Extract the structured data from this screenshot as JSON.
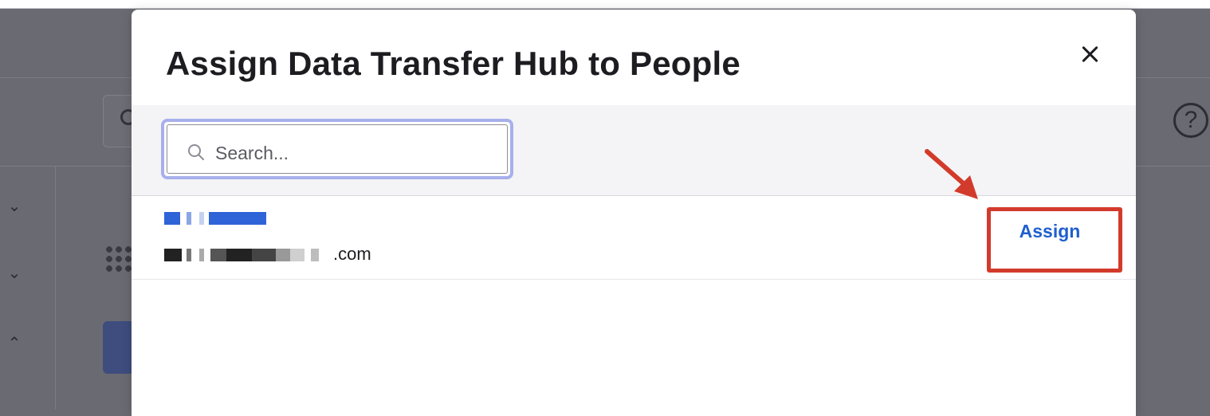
{
  "colors": {
    "accent": "#1f5fce",
    "annotation": "#d23b2b",
    "overlay": "#6a6b72",
    "focus_ring": "#a7b0eb"
  },
  "background": {
    "help_icon": "question-circle-icon",
    "help_glyph": "?"
  },
  "modal": {
    "title": "Assign Data Transfer Hub to People",
    "close_icon": "close-icon"
  },
  "search": {
    "placeholder": "Search...",
    "value": "",
    "icon": "search-icon"
  },
  "users": [
    {
      "name_redacted": true,
      "email_suffix": ".com",
      "action_label": "Assign"
    }
  ],
  "annotations": {
    "highlight": "assign-button",
    "arrow_icon": "arrow-icon"
  }
}
